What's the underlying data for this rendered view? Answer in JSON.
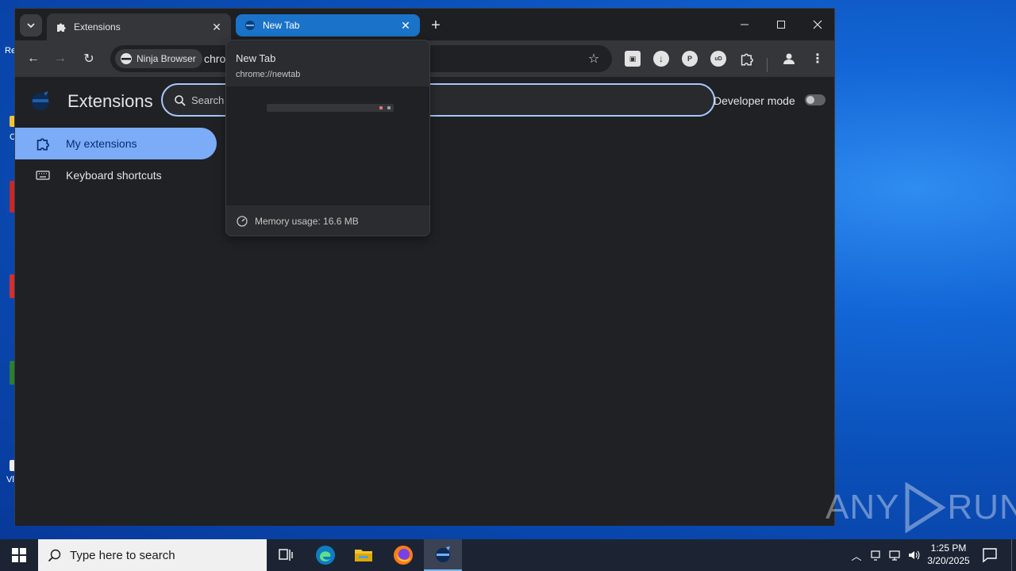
{
  "browser": {
    "tabs": [
      {
        "title": "Extensions",
        "close_glyph": "✕",
        "icon": "puzzle-icon"
      },
      {
        "title": "New Tab",
        "close_glyph": "✕",
        "icon": "ninja-icon"
      }
    ],
    "new_tab_glyph": "+",
    "window_controls": {
      "minimize": "—",
      "maximize": "☐",
      "close": "✕"
    },
    "toolbar": {
      "back": "←",
      "forward": "→",
      "reload": "↻",
      "site_chip": "Ninja Browser",
      "url": "chro",
      "bookmark_star": "☆",
      "extension_icon_ud": "uD"
    }
  },
  "extensions_page": {
    "title": "Extensions",
    "search_placeholder": "Search e",
    "developer_mode_label": "Developer mode",
    "developer_mode_on": false,
    "nav": [
      {
        "label": "My extensions",
        "active": true,
        "icon": "puzzle-outline-icon"
      },
      {
        "label": "Keyboard shortcuts",
        "active": false,
        "icon": "keyboard-icon"
      }
    ]
  },
  "hover_card": {
    "title": "New Tab",
    "url": "chrome://newtab",
    "memory": "Memory usage: 16.6 MB"
  },
  "watermark": {
    "left": "ANY",
    "right": "RUN"
  },
  "taskbar": {
    "search_placeholder": "Type here to search",
    "apps": [
      "task-view",
      "edge",
      "file-explorer",
      "firefox",
      "ninja-browser"
    ],
    "time": "1:25 PM",
    "date": "3/20/2025"
  },
  "desktop": {
    "edge_text": [
      "Re",
      "C",
      "Vl"
    ]
  },
  "colors": {
    "accent": "#7cacf8",
    "tab_active": "#1a73c9",
    "search_border": "#a8c7fa"
  }
}
